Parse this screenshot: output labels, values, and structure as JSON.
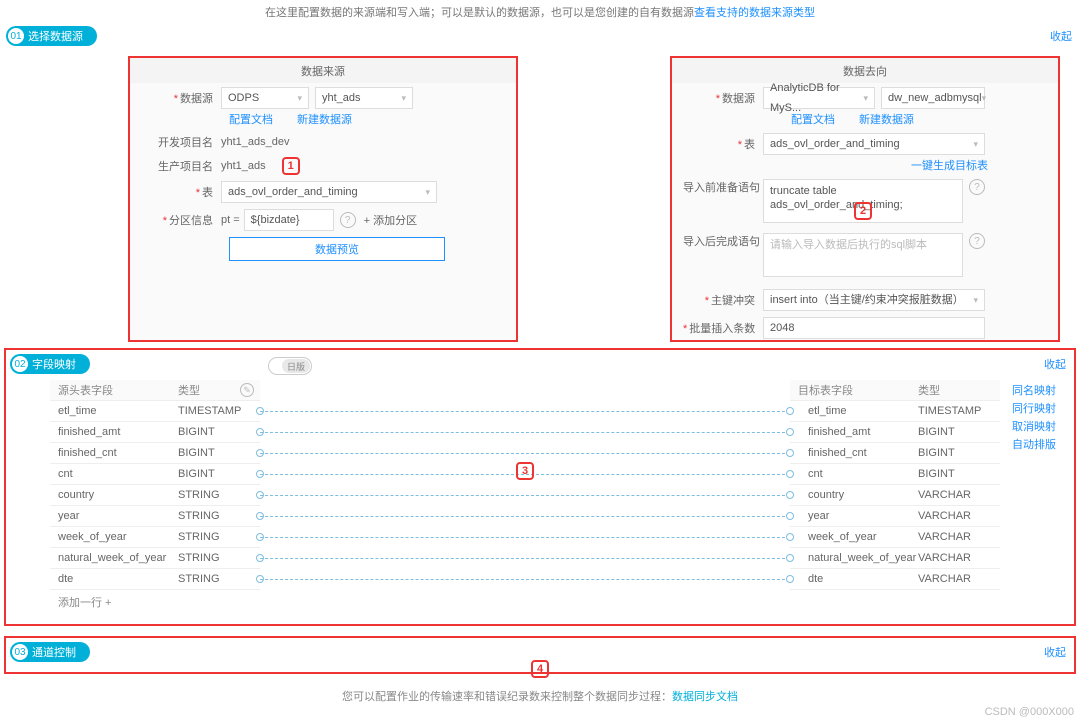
{
  "top_hint": {
    "text": "在这里配置数据的来源端和写入端；可以是默认的数据源，也可以是您创建的自有数据源",
    "link": "查看支持的数据来源类型"
  },
  "steps": {
    "s1_num": "01",
    "s1_label": "选择数据源",
    "s2_num": "02",
    "s2_label": "字段映射",
    "s3_num": "03",
    "s3_label": "通道控制",
    "collapse": "收起"
  },
  "source": {
    "title": "数据来源",
    "ds_label": "数据源",
    "ds_select1": "ODPS",
    "ds_select2": "yht_ads",
    "link_cfg": "配置文档",
    "link_new": "新建数据源",
    "dev_proj_label": "开发项目名",
    "dev_proj_val": "yht1_ads_dev",
    "prod_proj_label": "生产项目名",
    "prod_proj_val": "yht1_ads",
    "table_label": "表",
    "table_val": "ads_ovl_order_and_timing",
    "part_label": "分区信息",
    "part_prefix": "pt =",
    "part_val": "${bizdate}",
    "part_add": "+ 添加分区",
    "preview_btn": "数据预览",
    "badge": "1"
  },
  "target": {
    "title": "数据去向",
    "ds_label": "数据源",
    "ds_select1": "AnalyticDB for MyS...",
    "ds_select2": "dw_new_adbmysql",
    "link_cfg": "配置文档",
    "link_new": "新建数据源",
    "table_label": "表",
    "table_val": "ads_ovl_order_and_timing",
    "link_gen": "一键生成目标表",
    "pre_label": "导入前准备语句",
    "pre_val": "truncate table ads_ovl_order_and_timing;",
    "post_label": "导入后完成语句",
    "post_placeholder": "请输入导入数据后执行的sql脚本",
    "pk_label": "主键冲突",
    "pk_val": "insert into（当主键/约束冲突报脏数据）",
    "batch_label": "批量插入条数",
    "batch_val": "2048",
    "badge": "2"
  },
  "mapping": {
    "switch_label": "日版",
    "left_head_name": "源头表字段",
    "left_head_type": "类型",
    "right_head_name": "目标表字段",
    "right_head_type": "类型",
    "left": [
      {
        "n": "etl_time",
        "t": "TIMESTAMP"
      },
      {
        "n": "finished_amt",
        "t": "BIGINT"
      },
      {
        "n": "finished_cnt",
        "t": "BIGINT"
      },
      {
        "n": "cnt",
        "t": "BIGINT"
      },
      {
        "n": "country",
        "t": "STRING"
      },
      {
        "n": "year",
        "t": "STRING"
      },
      {
        "n": "week_of_year",
        "t": "STRING"
      },
      {
        "n": "natural_week_of_year",
        "t": "STRING"
      },
      {
        "n": "dte",
        "t": "STRING"
      }
    ],
    "right": [
      {
        "n": "etl_time",
        "t": "TIMESTAMP"
      },
      {
        "n": "finished_amt",
        "t": "BIGINT"
      },
      {
        "n": "finished_cnt",
        "t": "BIGINT"
      },
      {
        "n": "cnt",
        "t": "BIGINT"
      },
      {
        "n": "country",
        "t": "VARCHAR"
      },
      {
        "n": "year",
        "t": "VARCHAR"
      },
      {
        "n": "week_of_year",
        "t": "VARCHAR"
      },
      {
        "n": "natural_week_of_year",
        "t": "VARCHAR"
      },
      {
        "n": "dte",
        "t": "VARCHAR"
      }
    ],
    "add_row": "添加一行 +",
    "actions": [
      "同名映射",
      "同行映射",
      "取消映射",
      "自动排版"
    ],
    "badge": "3"
  },
  "channel": {
    "badge": "4"
  },
  "bottom_hint": {
    "text": "您可以配置作业的传输速率和错误纪录数来控制整个数据同步过程：",
    "link": "数据同步文档"
  },
  "watermark": "CSDN @000X000"
}
